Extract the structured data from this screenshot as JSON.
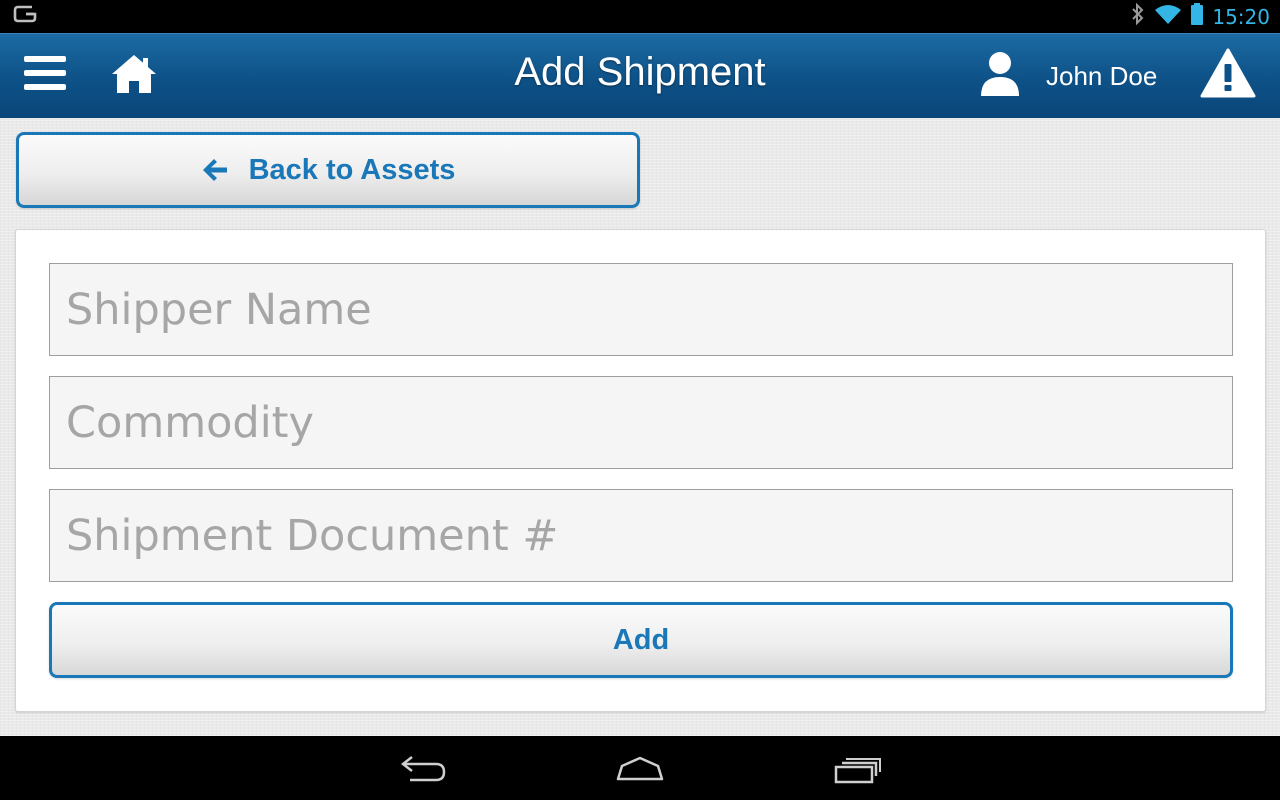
{
  "status_bar": {
    "time": "15:20",
    "icons": [
      "g-notification-icon",
      "bluetooth-icon",
      "wifi-icon",
      "battery-icon"
    ],
    "accent_color": "#33b5e5"
  },
  "app_bar": {
    "title": "Add Shipment",
    "user_name": "John Doe",
    "icons": [
      "hamburger-menu-icon",
      "home-icon",
      "user-icon",
      "warning-icon"
    ],
    "background_color": "#0d5187"
  },
  "back_button": {
    "label": "Back to Assets",
    "icon": "arrow-left-icon"
  },
  "form": {
    "fields": [
      {
        "placeholder": "Shipper Name",
        "value": ""
      },
      {
        "placeholder": "Commodity",
        "value": ""
      },
      {
        "placeholder": "Shipment Document #",
        "value": ""
      }
    ],
    "submit_label": "Add",
    "accent_color": "#1a77b8"
  },
  "nav_bar": {
    "icons": [
      "nav-back-icon",
      "nav-home-icon",
      "nav-recents-icon"
    ]
  }
}
